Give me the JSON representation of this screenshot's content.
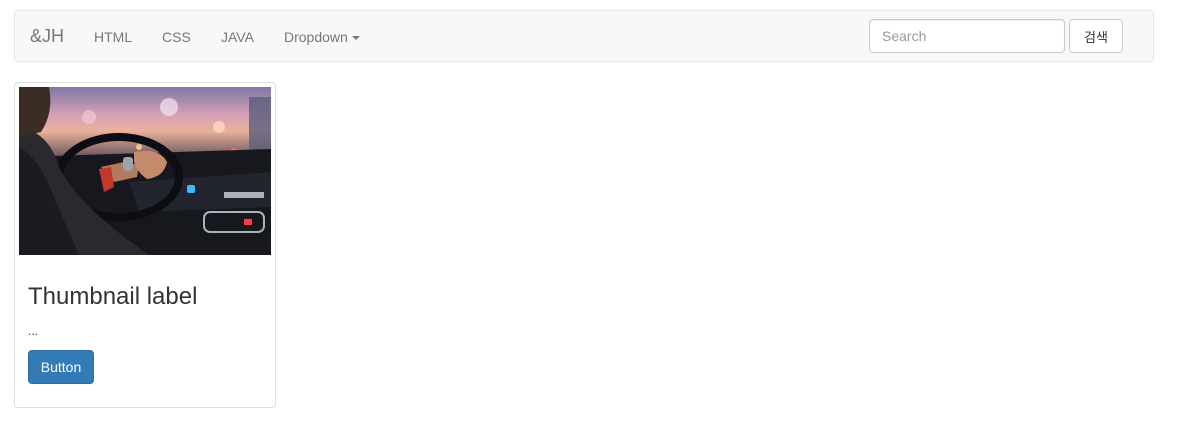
{
  "navbar": {
    "brand": "&JH",
    "links": [
      {
        "label": "HTML"
      },
      {
        "label": "CSS"
      },
      {
        "label": "JAVA"
      },
      {
        "label": "Dropdown"
      }
    ],
    "search": {
      "placeholder": "Search",
      "value": ""
    },
    "search_button_label": "검색"
  },
  "thumbnail": {
    "image_icon": "photo-of-person-driving-car-at-dusk",
    "title": "Thumbnail label",
    "text": "...",
    "button_label": "Button"
  },
  "colors": {
    "navbar_bg": "#f8f8f8",
    "primary_button": "#337ab7",
    "link_text": "#777777"
  }
}
